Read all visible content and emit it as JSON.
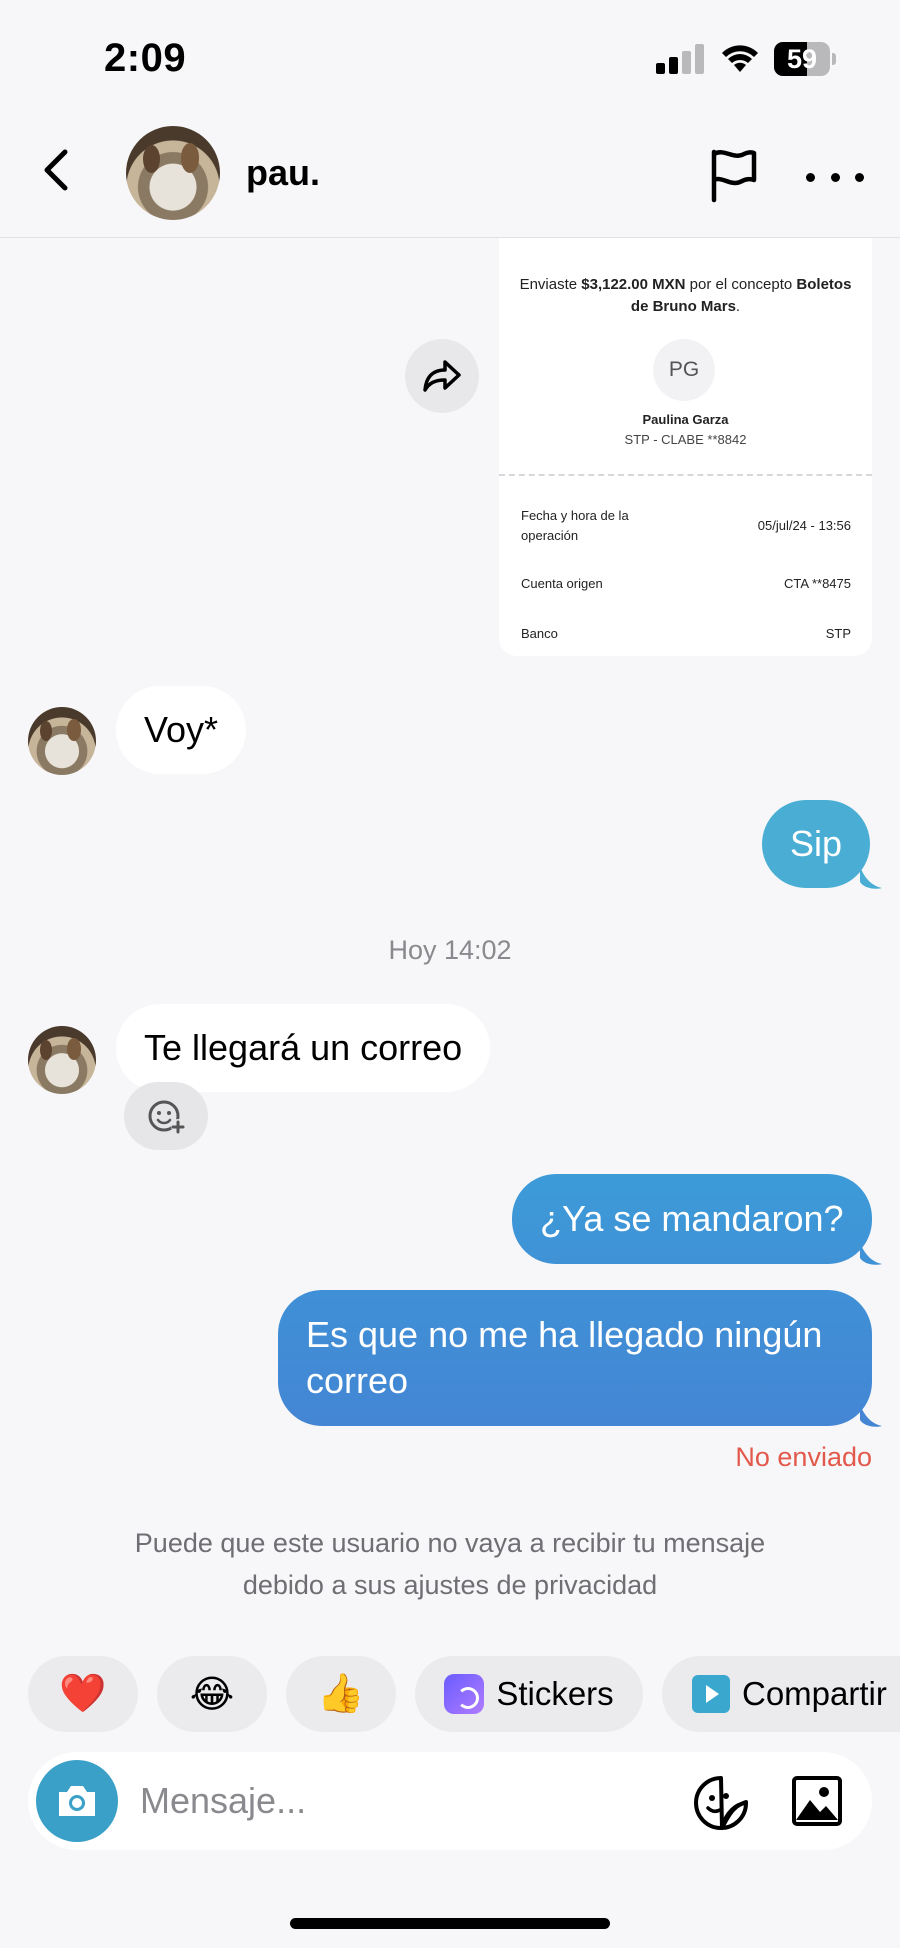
{
  "status_bar": {
    "time": "2:09",
    "battery": "59",
    "battery_level": 0.59
  },
  "header": {
    "name": "pau.",
    "icons": [
      "chevron-left-icon",
      "flag-icon",
      "more-dots-icon"
    ]
  },
  "receipt": {
    "line_prefix": "Enviaste ",
    "amount": "$3,122.00 MXN",
    "line_mid": " por el concepto ",
    "concept": "Boletos de Bruno Mars",
    "line_end": ".",
    "initials": "PG",
    "recipient_name": "Paulina Garza",
    "recipient_clabe": "STP - CLABE **8842",
    "rows": [
      {
        "label": "Fecha y hora de la operación",
        "value": "05/jul/24 - 13:56"
      },
      {
        "label": "Cuenta origen",
        "value": "CTA **8475"
      },
      {
        "label": "Banco",
        "value": "STP"
      }
    ]
  },
  "messages": {
    "m1": "Voy*",
    "m2": "Sip",
    "timestamp": "Hoy 14:02",
    "m3": "Te llegará un correo",
    "m4": "¿Ya se mandaron?",
    "m5": "Es que no me ha llegado ningún correo",
    "not_sent": "No enviado"
  },
  "privacy_note": "Puede que este usuario no vaya a recibir tu mensaje debido a sus ajustes de privacidad",
  "quick_actions": {
    "heart": "❤️",
    "laugh": "😂",
    "thumbs": "👍",
    "stickers_label": "Stickers",
    "share_label": "Compartir"
  },
  "composer": {
    "placeholder": "Mensaje..."
  },
  "colors": {
    "outgoing_light": "#4aaed4",
    "outgoing_dark": "#3f8fd6",
    "accent": "#3aa0c8",
    "error": "#e2594b"
  }
}
